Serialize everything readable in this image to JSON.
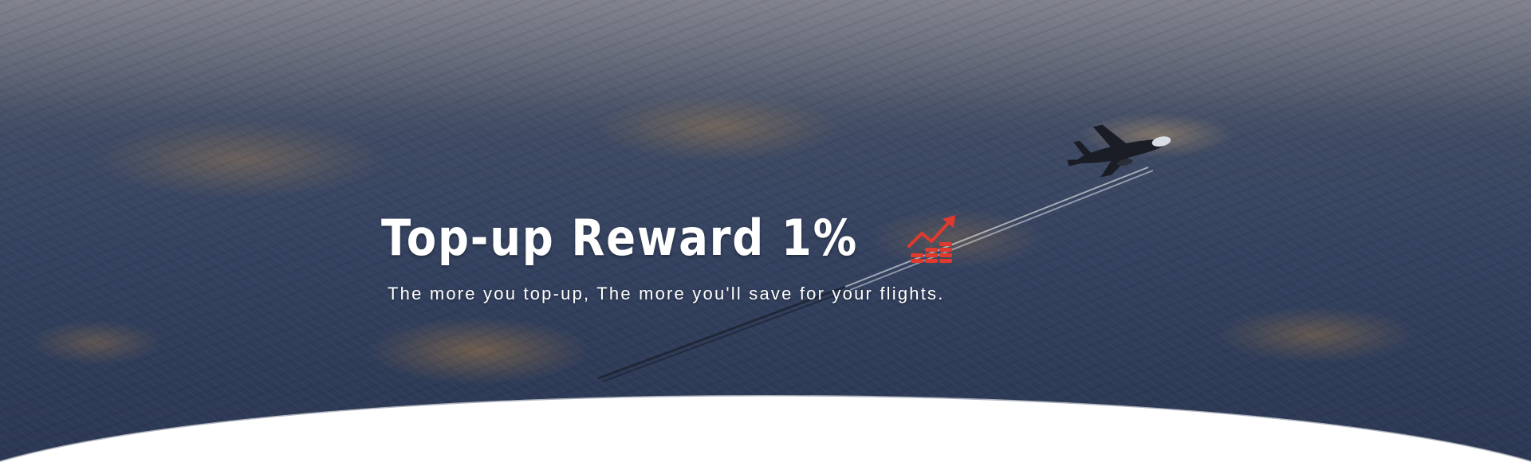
{
  "hero": {
    "title": "Top-up Reward 1%",
    "subtitle": "The more you top-up, The more you'll save for your flights.",
    "background_icon": "airplane-icon",
    "title_icon": "trending-up-coins-icon",
    "colors": {
      "title": "#ffffff",
      "icon_accent": "#e03a2e",
      "sky_overlay": "#344260",
      "bottom_curve": "#ffffff"
    }
  }
}
